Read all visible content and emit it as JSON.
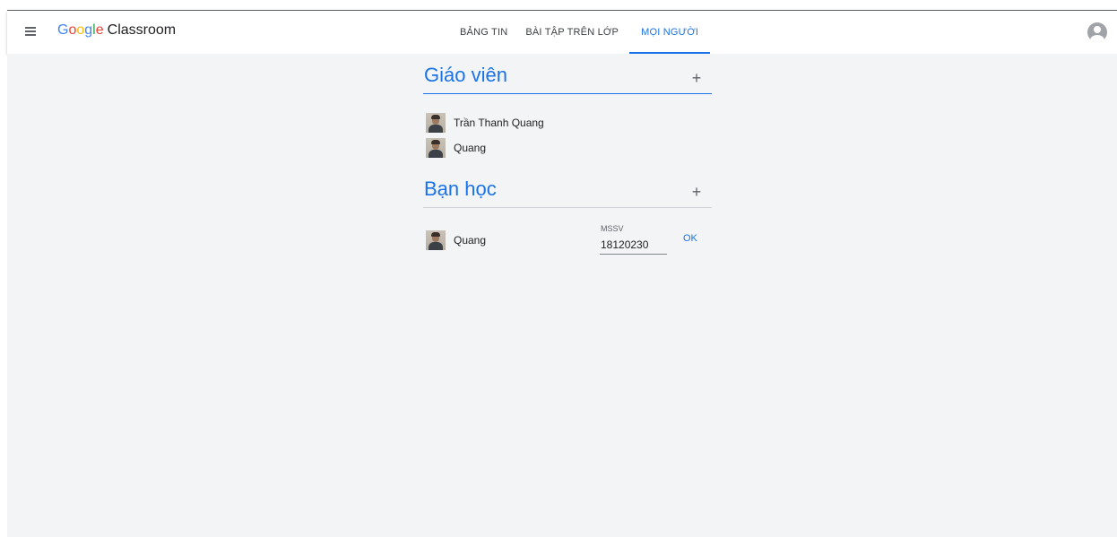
{
  "app": {
    "brand_letters": [
      {
        "ch": "G",
        "color": "#4285f4"
      },
      {
        "ch": "o",
        "color": "#ea4335"
      },
      {
        "ch": "o",
        "color": "#fbbc05"
      },
      {
        "ch": "g",
        "color": "#4285f4"
      },
      {
        "ch": "l",
        "color": "#34a853"
      },
      {
        "ch": "e",
        "color": "#ea4335"
      }
    ],
    "product": "Classroom"
  },
  "tabs": [
    {
      "label": "BẢNG TIN"
    },
    {
      "label": "BÀI TẬP TRÊN LỚP"
    },
    {
      "label": "MỌI NGƯỜI",
      "active": true
    }
  ],
  "icons": {
    "menu": "menu-icon",
    "account": "account-circle-icon",
    "add": "plus-icon"
  },
  "teachers": {
    "title": "Giáo viên",
    "add_symbol": "+",
    "members": [
      {
        "name": "Trần Thanh Quang"
      },
      {
        "name": "Quang"
      }
    ]
  },
  "classmates": {
    "title": "Bạn học",
    "add_symbol": "+",
    "members": [
      {
        "name": "Quang",
        "mssv_label": "MSSV",
        "mssv_value": "18120230",
        "ok_label": "OK"
      }
    ]
  },
  "colors": {
    "accent": "#1a73e8",
    "background": "#f3f4f6"
  }
}
